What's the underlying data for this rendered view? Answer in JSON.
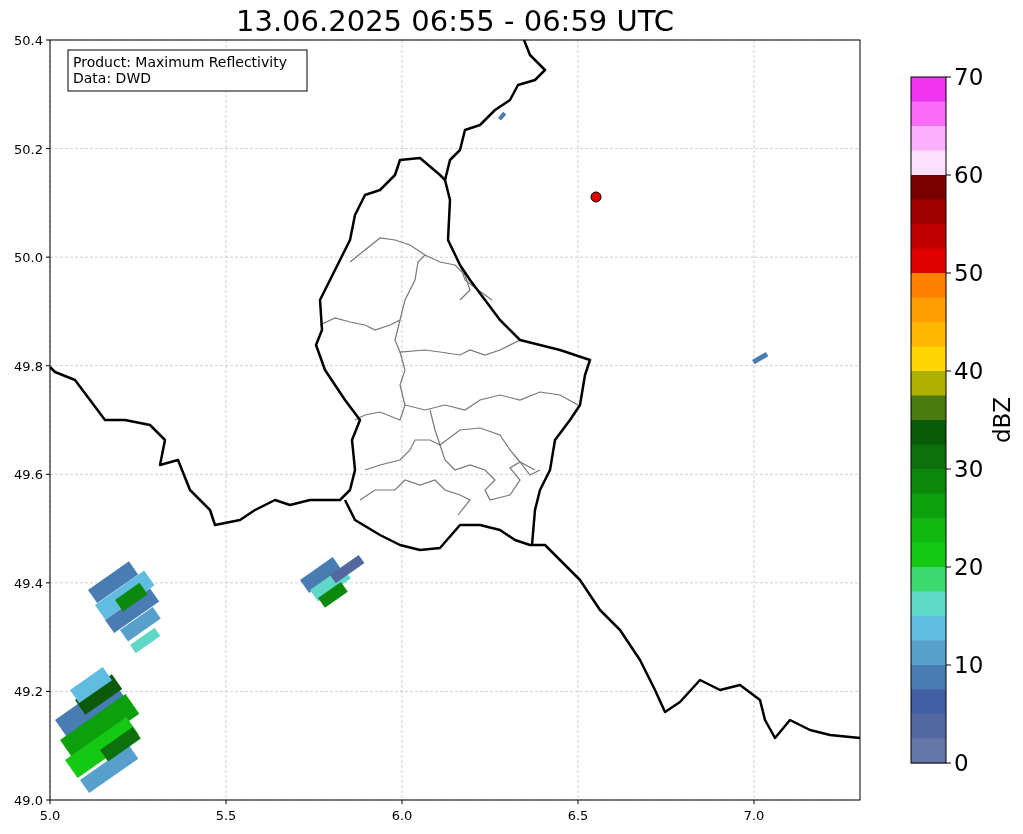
{
  "title": "13.06.2025 06:55 - 06:59 UTC",
  "info_box": [
    "Product: Maximum Reflectivity",
    "Data: DWD"
  ],
  "x_ticks": [
    "5.0",
    "5.5",
    "6.0",
    "6.5",
    "7.0"
  ],
  "y_ticks": [
    "50.4",
    "50.2",
    "50.0",
    "49.8",
    "49.6",
    "49.4",
    "49.2",
    "49.0"
  ],
  "colorbar": {
    "label": "dBZ",
    "ticks": [
      "70",
      "60",
      "50",
      "40",
      "30",
      "20",
      "10",
      "0"
    ],
    "segments": [
      {
        "color": "#f033ee"
      },
      {
        "color": "#f86cf8"
      },
      {
        "color": "#fcb0fc"
      },
      {
        "color": "#fde0fc"
      },
      {
        "color": "#7a0000"
      },
      {
        "color": "#a00000"
      },
      {
        "color": "#c00000"
      },
      {
        "color": "#e00000"
      },
      {
        "color": "#ff7f00"
      },
      {
        "color": "#ff9f00"
      },
      {
        "color": "#ffb700"
      },
      {
        "color": "#ffd700"
      },
      {
        "color": "#b0b000"
      },
      {
        "color": "#4a7a10"
      },
      {
        "color": "#0a5a0a"
      },
      {
        "color": "#0c700c"
      },
      {
        "color": "#0c880c"
      },
      {
        "color": "#0ca00c"
      },
      {
        "color": "#10b810"
      },
      {
        "color": "#14c814"
      },
      {
        "color": "#3cd870"
      },
      {
        "color": "#60d8c8"
      },
      {
        "color": "#60bce0"
      },
      {
        "color": "#58a0cc"
      },
      {
        "color": "#4a7cb4"
      },
      {
        "color": "#4460a4"
      },
      {
        "color": "#5468a0"
      },
      {
        "color": "#6478a8"
      }
    ]
  }
}
